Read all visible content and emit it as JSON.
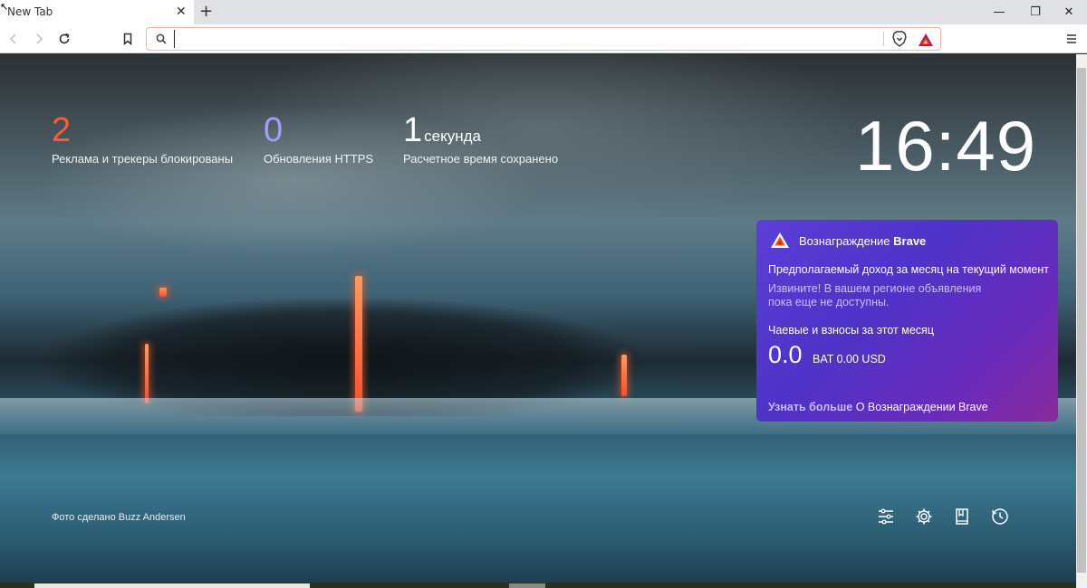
{
  "tab": {
    "title": "New Tab",
    "close": "✕",
    "new_tab": "+"
  },
  "window": {
    "minimize": "—",
    "restore": "❐",
    "close": "✕"
  },
  "urlbar": {
    "value": ""
  },
  "stats": [
    {
      "value": "2",
      "unit": "",
      "label": "Реклама и трекеры блокированы",
      "color": "#ff5a36"
    },
    {
      "value": "0",
      "unit": "",
      "label": "Обновления HTTPS",
      "color": "#a39cff"
    },
    {
      "value": "1",
      "unit": "секунда",
      "label": "Расчетное время сохранено",
      "color": "#ffffff"
    }
  ],
  "clock": "16:49",
  "rewards": {
    "title_prefix": "Вознаграждение",
    "title_brand": "Brave",
    "income_label": "Предполагаемый доход за месяц на текущий момент",
    "sorry_text": "Извините! В вашем регионе объявления пока еще не доступны.",
    "tips_label": "Чаевые и взносы за этот месяц",
    "amount": "0.0",
    "bat_usd": "BAT 0.00 USD",
    "learn_link": "Узнать больше",
    "learn_rest": "О Вознаграждении Brave",
    "accent": "#5b3fd6"
  },
  "photo_credit": "Фото сделано Buzz Andersen",
  "bottom_icons": [
    "customize-icon",
    "settings-icon",
    "bookmarks-icon",
    "history-icon"
  ]
}
